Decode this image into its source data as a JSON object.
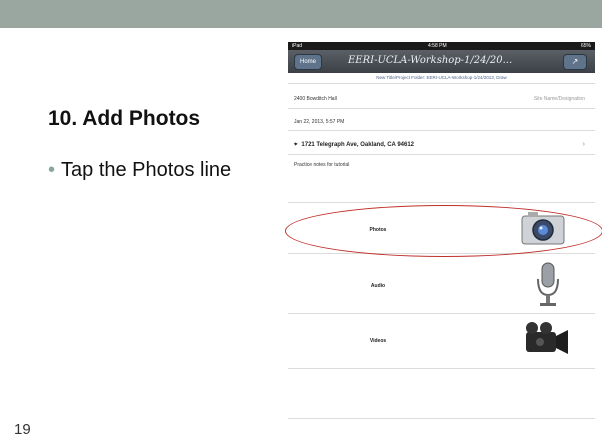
{
  "slide": {
    "title": "10. Add Photos",
    "bullet": "Tap the Photos line",
    "number": "19"
  },
  "ipad": {
    "status": {
      "left": "iPad",
      "time": "4:58 PM",
      "battery": "65%"
    },
    "nav": {
      "left_button": "Home",
      "title": "EERI-UCLA-Workshop-1/24/20...",
      "right_button": "share-icon"
    },
    "subline": "New Title/Project Folder: EERI-UCLA-Workshop-1/24/2013, Draw",
    "location_left": "2400 Bowditch Hall",
    "location_right": "Site Name/Designation",
    "timestamp": "Jan 22, 2013, 5:57 PM",
    "address": "1721 Telegraph Ave, Oakland, CA 94612",
    "notes": "Practice notes for tutorial",
    "media": {
      "photos": "Photos",
      "audio": "Audio",
      "videos": "Videos"
    }
  },
  "colors": {
    "top_bar": "#9aa7a1",
    "highlight": "#c0302b"
  }
}
